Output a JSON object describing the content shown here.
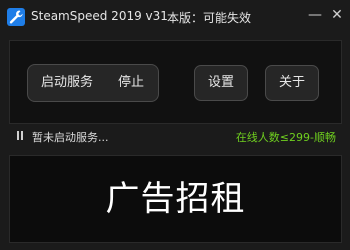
{
  "window": {
    "title": "SteamSpeed 2019 v31",
    "version_label": "本版：可能失效",
    "minimize_glyph": "—",
    "close_glyph": "✕"
  },
  "icons": {
    "app": "wrench-icon",
    "status": "pause-icon"
  },
  "controls": {
    "start_label": "启动服务",
    "stop_label": "停止",
    "settings_label": "设置",
    "about_label": "关于"
  },
  "status": {
    "message": "暂未启动服务...",
    "online": "在线人数≤299-顺畅"
  },
  "ad": {
    "text": "广告招租"
  },
  "colors": {
    "background": "#1b1b1b",
    "panel": "#111111",
    "button": "#262626",
    "accent_icon": "#1f7ee8",
    "online_green": "#6fcf1f",
    "text": "#e6e6e6"
  }
}
